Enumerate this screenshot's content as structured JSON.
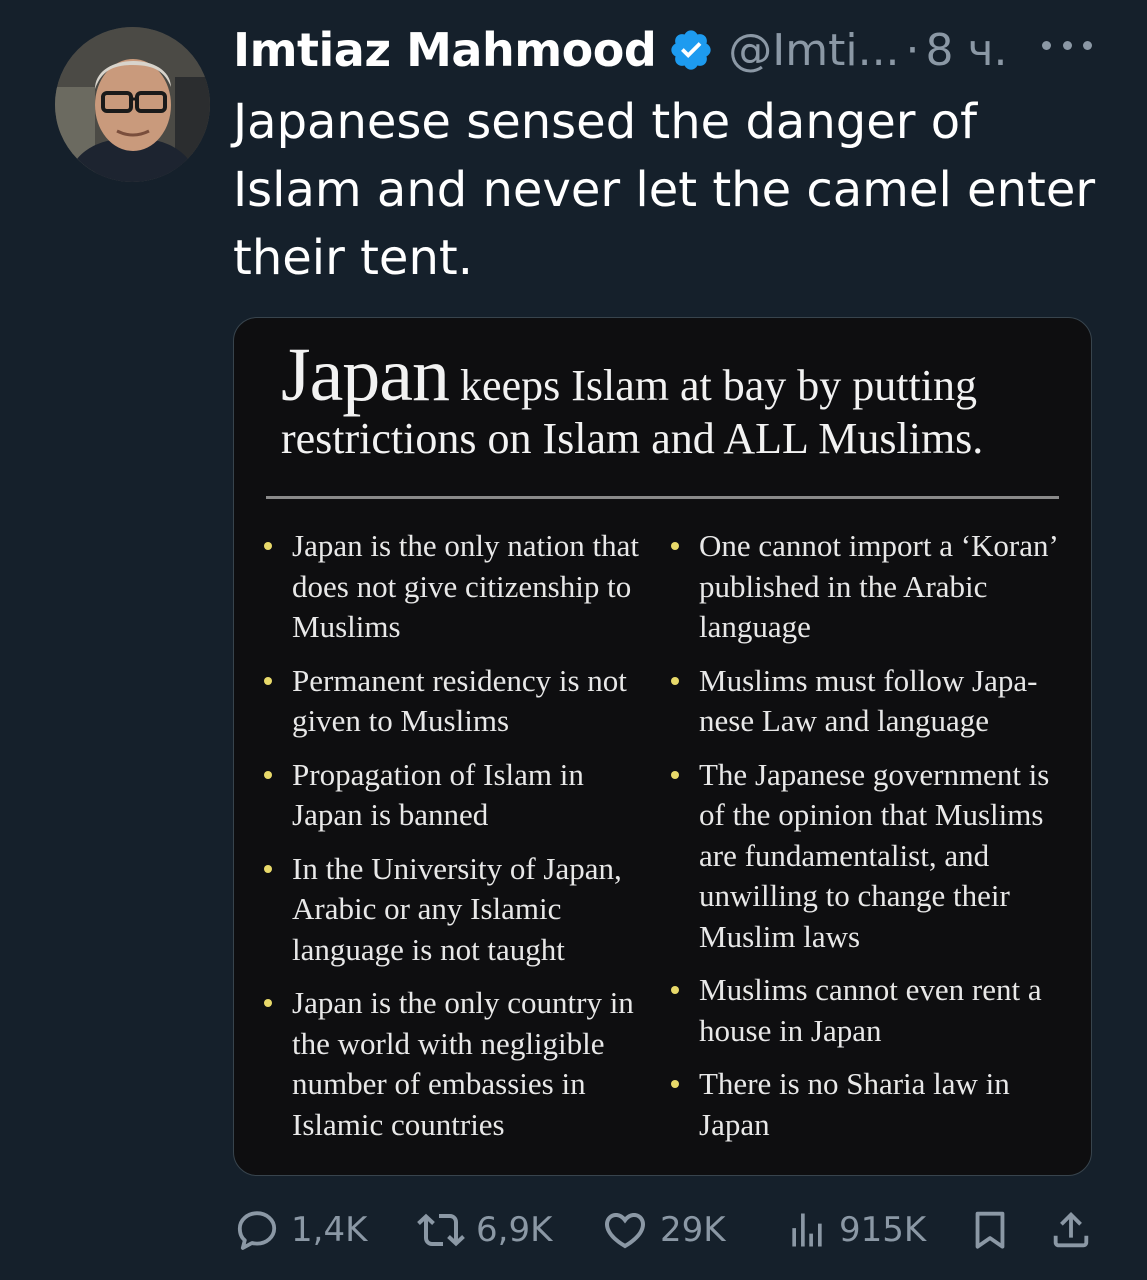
{
  "author": {
    "name": "Imtiaz Mahmood",
    "handle": "@Imti...",
    "separator": "·",
    "time": "8 ч."
  },
  "tweet": {
    "text": "Japanese sensed the danger of\nIslam and never let the camel enter\ntheir tent."
  },
  "image": {
    "title_big": "Japan",
    "title_rest": " keeps Islam at bay by putting",
    "title_line2": "restrictions on Islam and ALL Muslims.",
    "left_bullets": [
      "Japan is the only nation that does not give citizenship to Muslims",
      "Permanent residency is not given to Muslims",
      "Propagation of Islam in Japan is banned",
      "In the University of Japan, Arabic or any Islamic language is not taught",
      "Japan is the only country in the world with negligible number of embassies in Islamic countries"
    ],
    "right_bullets": [
      "One cannot import a ‘Koran’ published in the Arabic language",
      "Muslims must follow Japa-nese Law and language",
      "The Japanese government is of the opinion that Muslims are fundamentalist, and unwilling to change their Muslim laws",
      "Muslims cannot even rent a house in Japan",
      "There is no Sharia law in Japan"
    ],
    "bullet_color": "#e8d96a"
  },
  "actions": {
    "replies": "1,4K",
    "reposts": "6,9K",
    "likes": "29K",
    "views": "915K"
  },
  "icons": [
    "verified-badge-icon",
    "more-icon",
    "reply-icon",
    "repost-icon",
    "like-icon",
    "views-icon",
    "bookmark-icon",
    "share-icon"
  ],
  "colors": {
    "background": "#15202b",
    "muted_text": "#8b98a5",
    "verified_blue": "#1d9bf0"
  }
}
